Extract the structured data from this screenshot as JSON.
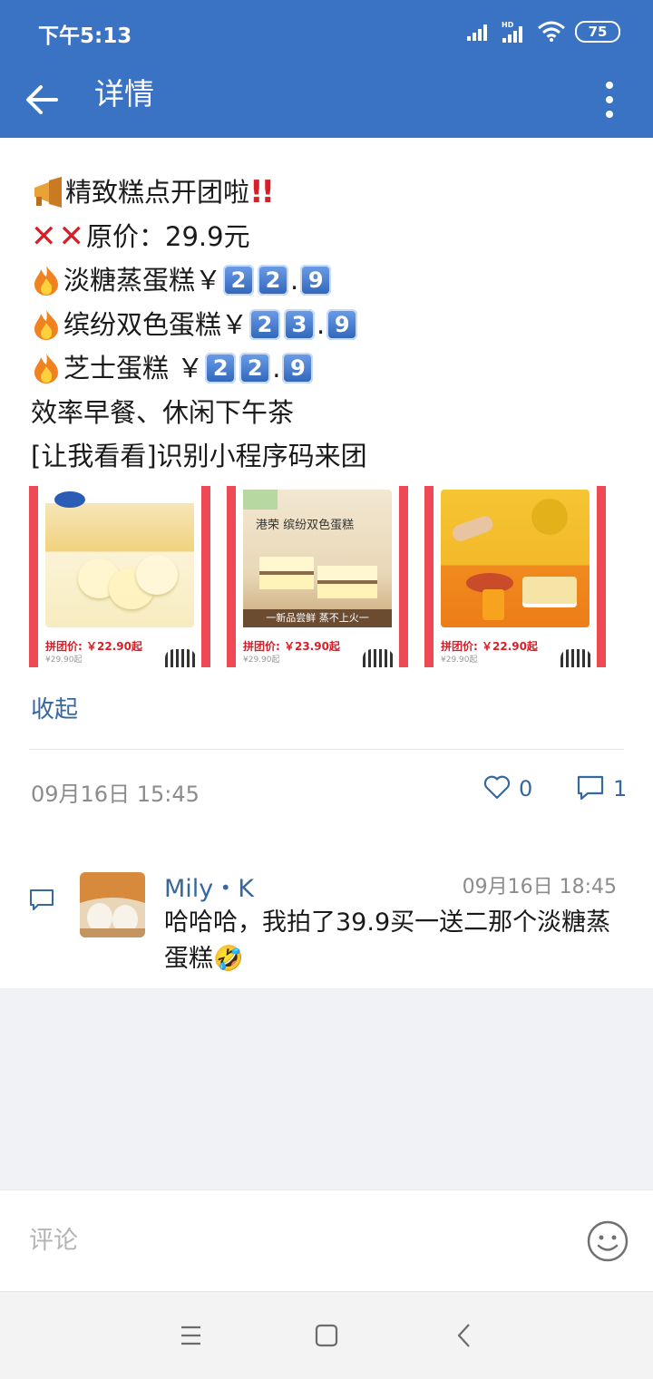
{
  "status_bar": {
    "time": "下午5:13",
    "battery": "75"
  },
  "app_bar": {
    "title": "详情"
  },
  "post": {
    "lines": {
      "l1": "精致糕点开团啦",
      "l2_text": "原价：29.9元",
      "l3_name": "淡糖蒸蛋糕",
      "l3_price": [
        "2",
        "2",
        "9"
      ],
      "l4_name": "缤纷双色蛋糕",
      "l4_price": [
        "2",
        "3",
        "9"
      ],
      "l5_name": "芝士蛋糕 ",
      "l5_price": [
        "2",
        "2",
        "9"
      ],
      "l6": "效率早餐、休闲下午茶",
      "l7": "[让我看看]识别小程序码来团"
    },
    "currency": "￥",
    "dot": ".",
    "thumbnails": [
      {
        "price": "拼团价: ￥22.90起",
        "orig": "¥29.90起"
      },
      {
        "price": "拼团价: ￥23.90起",
        "orig": "¥29.90起",
        "banner_top": "港荣  缤纷双色蛋糕",
        "banner_bottom": "一新品尝鲜 蒸不上火一"
      },
      {
        "price": "拼团价: ￥22.90起",
        "orig": "¥29.90起"
      }
    ],
    "collapse_label": "收起",
    "time": "09月16日 15:45",
    "likes": "0",
    "comments": "1"
  },
  "comment": {
    "name": "Mily・K",
    "time": "09月16日 18:45",
    "text": "哈哈哈，我拍了39.9买一送二那个淡糖蒸蛋糕🤣"
  },
  "input": {
    "placeholder": "评论"
  },
  "colors": {
    "primary": "#3a73c4",
    "link": "#36689f",
    "accent_red": "#d81e28"
  }
}
